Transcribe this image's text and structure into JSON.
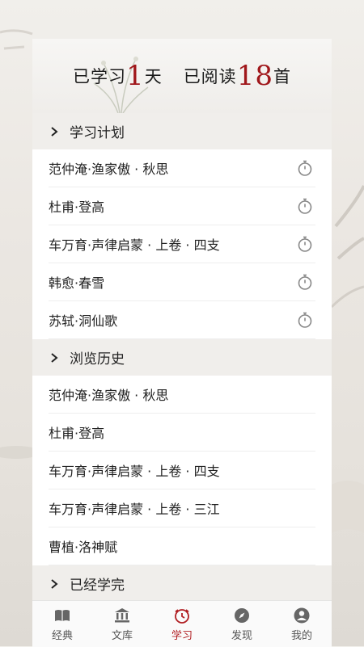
{
  "banner": {
    "learned_prefix": "已学习",
    "learned_days": "1",
    "learned_suffix": "天",
    "read_prefix": "已阅读",
    "read_count": "18",
    "read_suffix": "首"
  },
  "sections": [
    {
      "title": "学习计划",
      "items": [
        "范仲淹·渔家傲 · 秋思",
        "杜甫·登高",
        "车万育·声律启蒙 · 上卷 · 四支",
        "韩愈·春雪",
        "苏轼·洞仙歌"
      ]
    },
    {
      "title": "浏览历史",
      "items": [
        "范仲淹·渔家傲 · 秋思",
        "杜甫·登高",
        "车万育·声律启蒙 · 上卷 · 四支",
        "车万育·声律启蒙 · 上卷 · 三江",
        "曹植·洛神赋"
      ]
    },
    {
      "title": "已经学完",
      "items": []
    }
  ],
  "tabs": [
    {
      "label": "经典",
      "icon": "book-icon"
    },
    {
      "label": "文库",
      "icon": "library-icon"
    },
    {
      "label": "学习",
      "icon": "study-icon",
      "active": true
    },
    {
      "label": "发现",
      "icon": "compass-icon"
    },
    {
      "label": "我的",
      "icon": "profile-icon"
    }
  ],
  "colors": {
    "accent": "#b11f23",
    "number": "#a0171b",
    "section_bg": "#f0eeeb"
  }
}
